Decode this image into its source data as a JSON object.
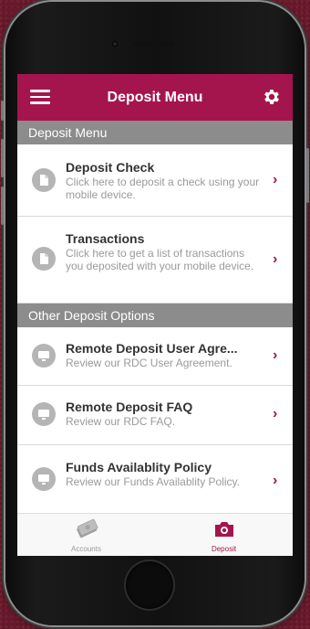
{
  "navbar": {
    "title": "Deposit Menu"
  },
  "sections": [
    {
      "header": "Deposit Menu",
      "items": [
        {
          "title": "Deposit Check",
          "subtitle": "Click here to deposit a check using your mobile device.",
          "icon": "document-icon"
        },
        {
          "title": "Transactions",
          "subtitle": "Click here to get a list of transactions you deposited with your mobile device.",
          "icon": "document-icon"
        }
      ]
    },
    {
      "header": "Other Deposit Options",
      "items": [
        {
          "title": "Remote Deposit User Agre...",
          "subtitle": "Review our RDC User Agreement.",
          "icon": "monitor-icon"
        },
        {
          "title": "Remote Deposit FAQ",
          "subtitle": "Review our RDC FAQ.",
          "icon": "monitor-icon"
        },
        {
          "title": "Funds Availablity Policy",
          "subtitle": "Review our Funds Availablity Policy.",
          "icon": "monitor-icon"
        }
      ]
    }
  ],
  "tabbar": {
    "tabs": [
      {
        "label": "Accounts",
        "icon": "accounts-icon",
        "active": false
      },
      {
        "label": "Deposit",
        "icon": "camera-icon",
        "active": true
      }
    ]
  },
  "colors": {
    "brand": "#a5154d",
    "section_header": "#8c8c8c",
    "inactive_tab": "#9a9a9a"
  }
}
